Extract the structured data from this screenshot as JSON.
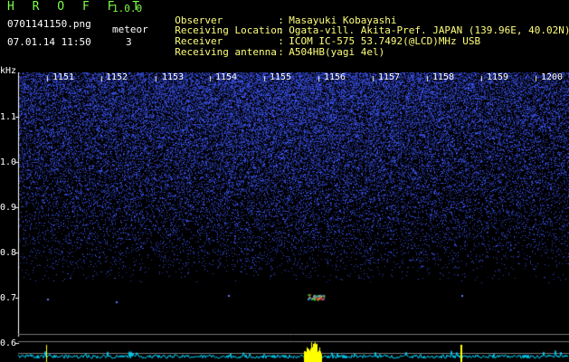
{
  "app": {
    "title": "H R O F F T",
    "version": "1.0.0",
    "filename": "0701141150.png",
    "datetime": "07.01.14 11:50",
    "meteor_label": "meteor",
    "meteor_count": "3"
  },
  "info": [
    {
      "key": "Observer",
      "sep": ":",
      "value": "Masayuki Kobayashi"
    },
    {
      "key": "Receiving Location",
      "sep": ":",
      "value": "Ogata-vill. Akita-Pref. JAPAN (139.96E, 40.02N)"
    },
    {
      "key": "Receiver",
      "sep": ":",
      "value": "ICOM IC-575 53.7492(@LCD)MHz USB"
    },
    {
      "key": "Receiving antenna",
      "sep": ":",
      "value": "A504HB(yagi 4el)"
    }
  ],
  "axis": {
    "unit": "kHz",
    "y_ticks": [
      "1.1",
      "1.0",
      "0.9",
      "0.8",
      "0.7",
      "0.6"
    ],
    "x_ticks": [
      "1151",
      "1152",
      "1153",
      "1154",
      "1155",
      "1156",
      "1157",
      "1158",
      "1159",
      "1200"
    ]
  },
  "colors": {
    "background": "#000000",
    "noise": "#3a4cff",
    "title": "#7dff4a",
    "info": "#ffff7a",
    "echo": "#ffff00",
    "trace": "#00e0ff"
  }
}
